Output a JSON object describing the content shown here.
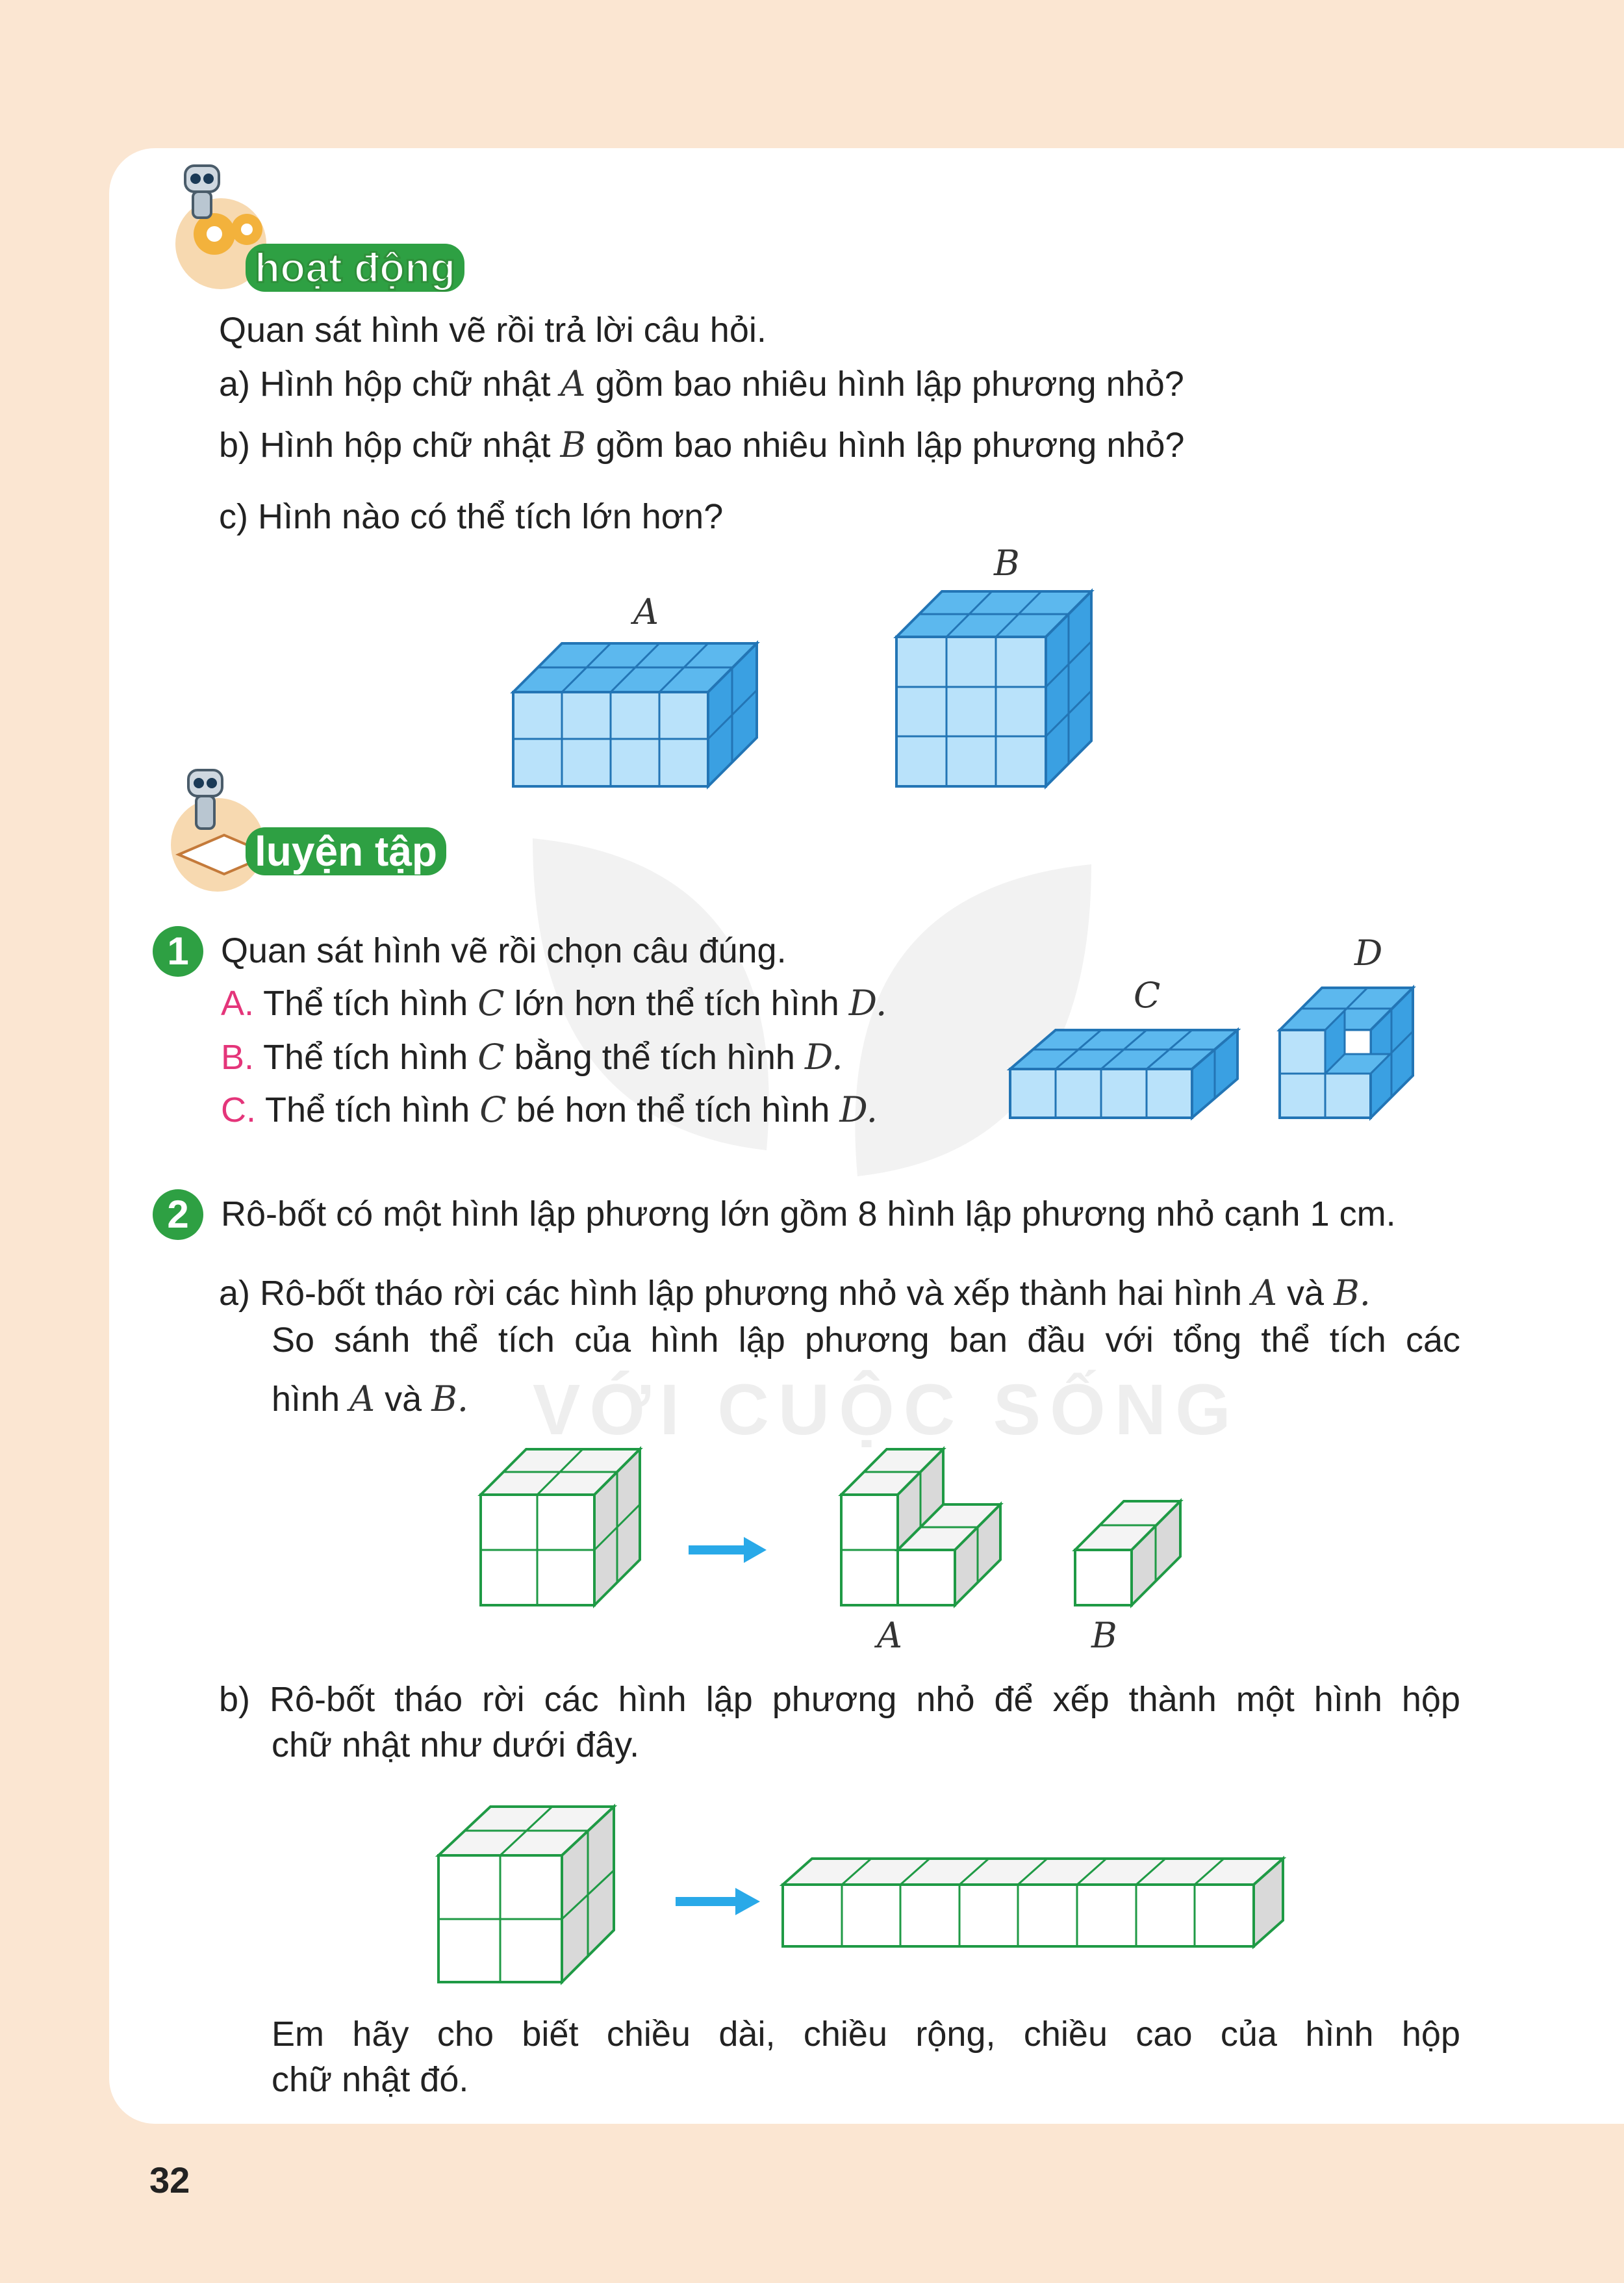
{
  "activity": {
    "header": "hoạt động",
    "intro": "Quan sát hình vẽ rồi trả lời câu hỏi.",
    "qa_prefix": "a) Hình hộp chữ nhật",
    "qa_suffix": "gồm bao nhiêu hình lập phương nhỏ?",
    "qb_prefix": "b) Hình hộp chữ nhật",
    "qb_suffix": "gồm bao nhiêu hình lập phương nhỏ?",
    "qc": "c) Hình nào có thể tích lớn hơn?",
    "label_a": "A",
    "label_b": "B"
  },
  "practice": {
    "header": "luyện tập",
    "ex1": {
      "number": "1",
      "title": "Quan sát hình vẽ rồi chọn câu đúng.",
      "options": [
        {
          "letter": "A.",
          "p1": "Thể tích hình",
          "l1": "C",
          "p2": "lớn hơn thể tích hình",
          "l2": "D."
        },
        {
          "letter": "B.",
          "p1": "Thể tích hình",
          "l1": "C",
          "p2": "bằng thể tích hình",
          "l2": "D."
        },
        {
          "letter": "C.",
          "p1": "Thể tích hình",
          "l1": "C",
          "p2": "bé hơn thể tích hình",
          "l2": "D."
        }
      ],
      "label_c": "C",
      "label_d": "D"
    },
    "ex2": {
      "number": "2",
      "title": "Rô-bốt có một hình lập phương lớn gồm 8 hình lập phương nhỏ cạnh 1 cm.",
      "a_line1_prefix": "a) Rô-bốt tháo rời các hình lập phương nhỏ và xếp thành hai hình",
      "a_line1_l1": "A",
      "a_line1_mid": "và",
      "a_line1_l2": "B.",
      "a_line2": "So sánh thể tích của hình lập phương ban đầu với tổng thể tích các",
      "a_line3_prefix": "hình",
      "a_line3_l1": "A",
      "a_line3_mid": "và",
      "a_line3_l2": "B.",
      "fig_label_a": "A",
      "fig_label_b": "B",
      "b_line1": "b) Rô-bốt tháo rời các hình lập phương nhỏ để xếp thành một hình hộp",
      "b_line2": "chữ nhật như dưới đây.",
      "b_q_line1": "Em hãy cho biết chiều dài, chiều rộng, chiều cao của hình hộp",
      "b_q_line2": "chữ nhật đó."
    }
  },
  "watermark": "VỚI CUỘC SỐNG",
  "page_number": "32",
  "colors": {
    "pink": "#e4357a",
    "green_badge": "#2ea043",
    "blue_cube": "#8fd0f5",
    "green_line": "#1f9a45",
    "arrow": "#29a9e8",
    "page_bg": "#fbe6d2"
  }
}
